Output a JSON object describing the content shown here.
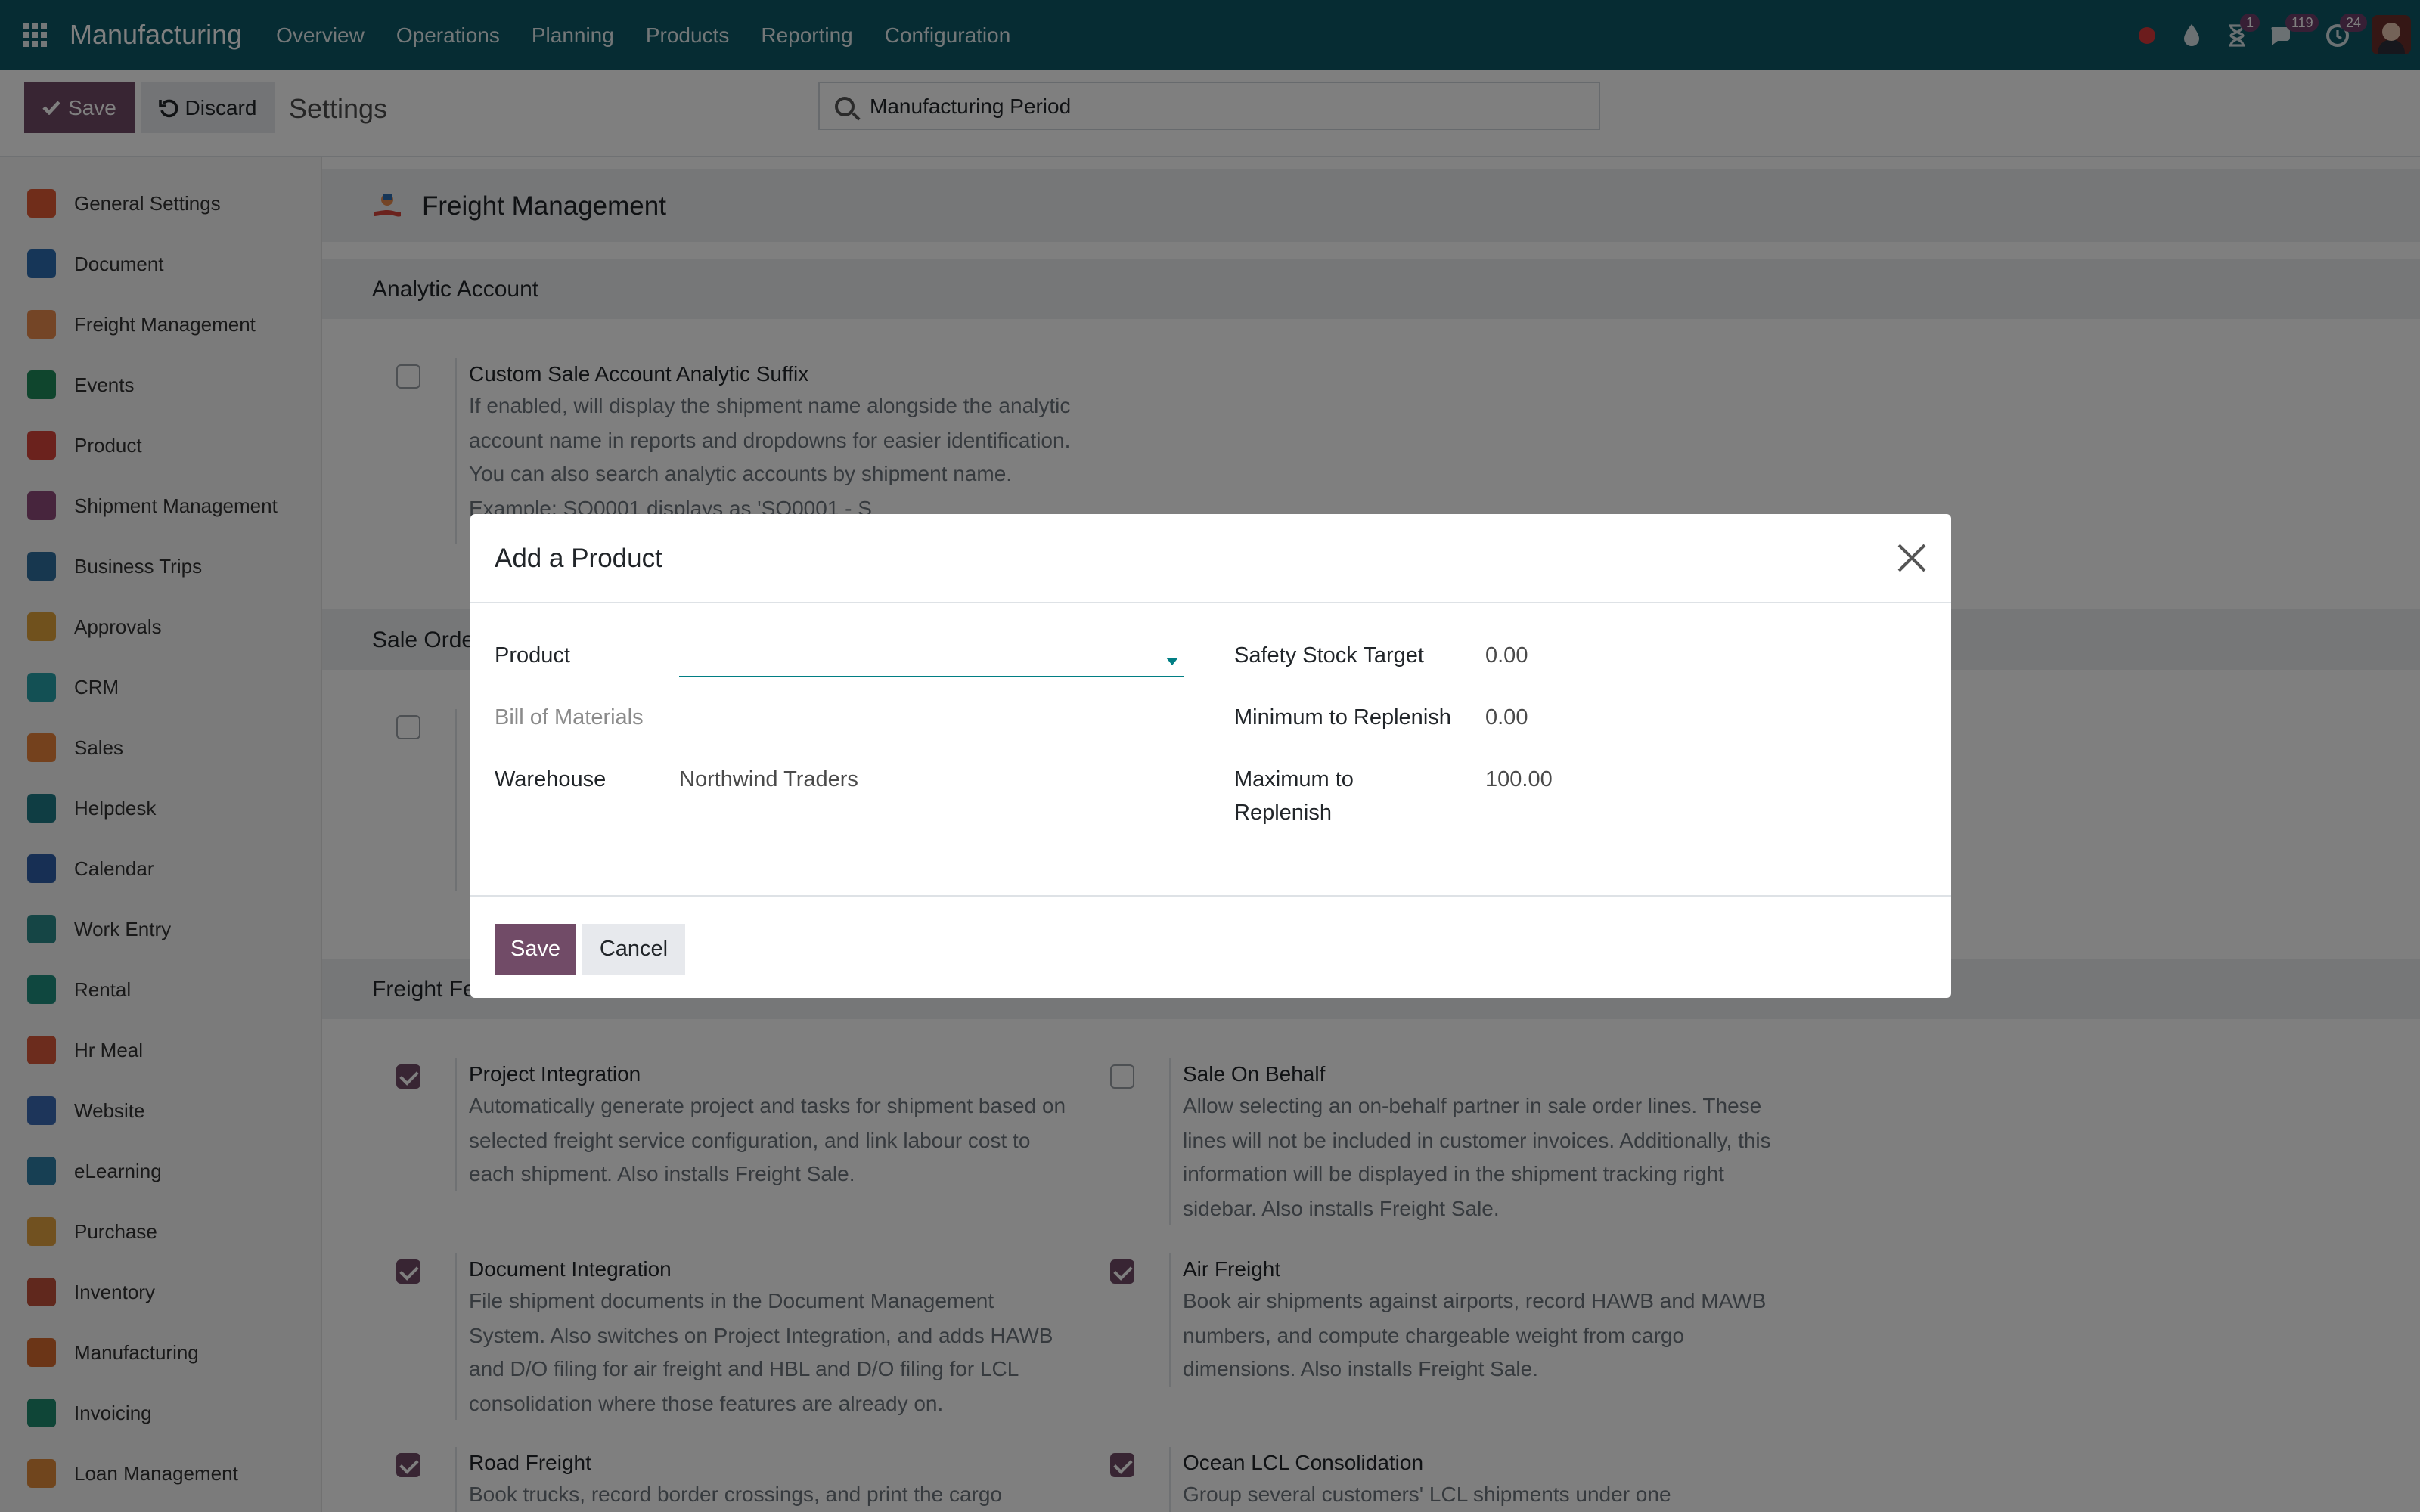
{
  "navbar": {
    "brand": "Manufacturing",
    "menu": [
      "Overview",
      "Operations",
      "Planning",
      "Products",
      "Reporting",
      "Configuration"
    ],
    "badges": {
      "activities": "1",
      "messages": "119",
      "updates": "24"
    }
  },
  "control": {
    "save_label": "Save",
    "discard_label": "Discard",
    "title": "Settings",
    "search_value": "Manufacturing Period"
  },
  "sidebar": {
    "items": [
      {
        "label": "General Settings",
        "icon": "general-settings-icon",
        "color": "#e05b35"
      },
      {
        "label": "Document",
        "icon": "folder-icon",
        "color": "#2c6cb0"
      },
      {
        "label": "Freight Management",
        "icon": "freight-icon",
        "color": "#e88a4d"
      },
      {
        "label": "Events",
        "icon": "events-icon",
        "color": "#1f8a5a"
      },
      {
        "label": "Product",
        "icon": "product-icon",
        "color": "#d6453a"
      },
      {
        "label": "Shipment Management",
        "icon": "shipment-icon",
        "color": "#8e4a7a"
      },
      {
        "label": "Business Trips",
        "icon": "business-trips-icon",
        "color": "#2f6f9f"
      },
      {
        "label": "Approvals",
        "icon": "approvals-icon",
        "color": "#e0a23a"
      },
      {
        "label": "CRM",
        "icon": "crm-icon",
        "color": "#26a0a8"
      },
      {
        "label": "Sales",
        "icon": "sales-icon",
        "color": "#e8833a"
      },
      {
        "label": "Helpdesk",
        "icon": "helpdesk-icon",
        "color": "#1f7a86"
      },
      {
        "label": "Calendar",
        "icon": "calendar-icon",
        "color": "#2f5fa8"
      },
      {
        "label": "Work Entry",
        "icon": "work-entry-icon",
        "color": "#2b8a8a"
      },
      {
        "label": "Rental",
        "icon": "rental-icon",
        "color": "#1f8f7e"
      },
      {
        "label": "Hr Meal",
        "icon": "hr-meal-icon",
        "color": "#d9593b"
      },
      {
        "label": "Website",
        "icon": "website-icon",
        "color": "#3a6bb5"
      },
      {
        "label": "eLearning",
        "icon": "elearning-icon",
        "color": "#2f7fa7"
      },
      {
        "label": "Purchase",
        "icon": "purchase-icon",
        "color": "#e3a341"
      },
      {
        "label": "Inventory",
        "icon": "inventory-icon",
        "color": "#c0503b"
      },
      {
        "label": "Manufacturing",
        "icon": "manufacturing-icon",
        "color": "#d66a2e"
      },
      {
        "label": "Invoicing",
        "icon": "invoicing-icon",
        "color": "#1f8a6f"
      },
      {
        "label": "Loan Management",
        "icon": "loan-management-icon",
        "color": "#e08a3a"
      }
    ]
  },
  "main": {
    "app_title": "Freight Management",
    "sections": [
      "Analytic Account",
      "Sale Orde",
      "Freight Fe"
    ],
    "settings": [
      {
        "name": "Custom Sale Account Analytic Suffix",
        "desc": "If enabled, will display the shipment name alongside the analytic account name in reports and dropdowns for easier identification. You can also search analytic accounts by shipment name. Example: SO0001 displays as 'SO0001 - S",
        "checked": false
      },
      {
        "name": "Project Integration",
        "desc": "Automatically generate project and tasks for shipment based on selected freight service configuration, and link labour cost to each shipment. Also installs Freight Sale.",
        "checked": true
      },
      {
        "name": "Sale On Behalf",
        "desc": "Allow selecting an on-behalf partner in sale order lines. These lines will not be included in customer invoices. Additionally, this information will be displayed in the shipment tracking right sidebar. Also installs Freight Sale.",
        "checked": false
      },
      {
        "name": "Document Integration",
        "desc": "File shipment documents in the Document Management System. Also switches on Project Integration, and adds HAWB and D/O filing for air freight and HBL and D/O filing for LCL consolidation where those features are already on.",
        "checked": true
      },
      {
        "name": "Air Freight",
        "desc": "Book air shipments against airports, record HAWB and MAWB numbers, and compute chargeable weight from cargo dimensions. Also installs Freight Sale.",
        "checked": true
      },
      {
        "name": "Road Freight",
        "desc": "Book trucks, record border crossings, and print the cargo",
        "checked": true
      },
      {
        "name": "Ocean LCL Consolidation",
        "desc": "Group several customers' LCL shipments under one",
        "checked": true
      }
    ]
  },
  "dialog": {
    "title": "Add a Product",
    "product_label": "Product",
    "product_value": "",
    "bom_label": "Bill of Materials",
    "warehouse_label": "Warehouse",
    "warehouse_value": "Northwind Traders",
    "safety_label": "Safety Stock Target",
    "safety_value": "0.00",
    "min_label": "Minimum to Replenish",
    "min_value": "0.00",
    "max_label_1": "Maximum to",
    "max_label_2": "Replenish",
    "max_value": "100.00",
    "save_label": "Save",
    "cancel_label": "Cancel"
  }
}
